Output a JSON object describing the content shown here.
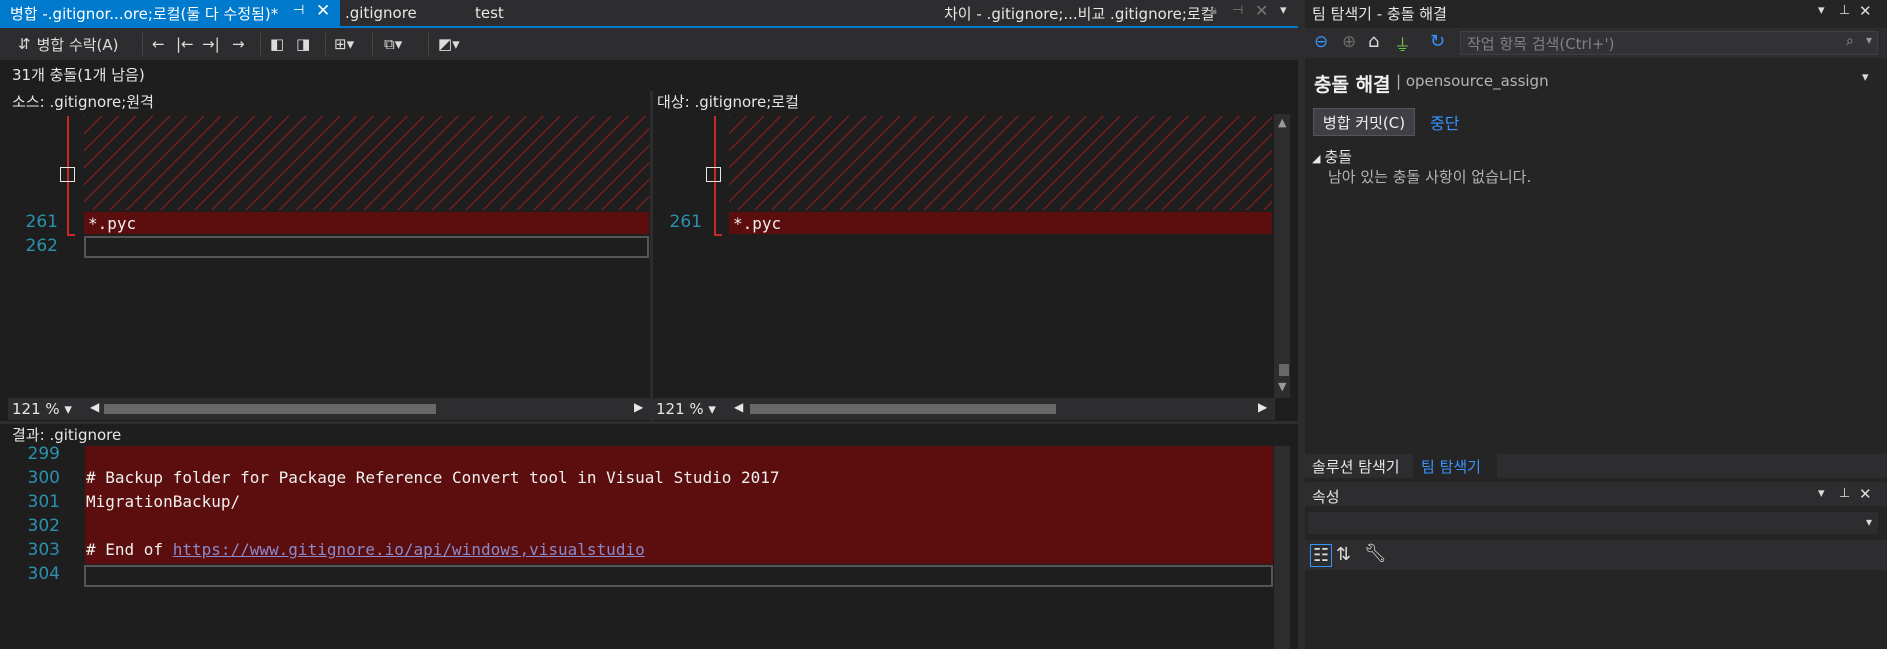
{
  "tabs": {
    "active": ".gitignor...ore;로컬(둘 다 수정됨)*",
    "active_prefix": "병합 - ",
    "items": [
      ".gitignore",
      "test"
    ],
    "right_doc": "차이 - .gitignore;...비교 .gitignore;로컬"
  },
  "toolbar": {
    "accept_merge": "병합 수락(A)"
  },
  "status": "31개 충돌(1개 남음)",
  "source": {
    "label_key": "소스:",
    "label_value": ".gitignore;원격",
    "lines": [
      {
        "num": "261",
        "text": "*.pyc"
      },
      {
        "num": "262",
        "text": ""
      }
    ],
    "zoom": "121 %"
  },
  "target": {
    "label_key": "대상:",
    "label_value": ".gitignore;로컬",
    "lines": [
      {
        "num": "261",
        "text": "*.pyc"
      }
    ],
    "zoom": "121 %"
  },
  "result": {
    "label_key": "결과:",
    "label_value": ".gitignore",
    "lines": [
      {
        "num": "299",
        "text": ""
      },
      {
        "num": "300",
        "text": "# Backup folder for Package Reference Convert tool in Visual Studio 2017"
      },
      {
        "num": "301",
        "text": "MigrationBackup/"
      },
      {
        "num": "302",
        "text": ""
      },
      {
        "num": "303",
        "text": "# End of "
      },
      {
        "num": "304",
        "text": ""
      }
    ],
    "link": "https://www.gitignore.io/api/windows,visualstudio"
  },
  "team_explorer": {
    "title": "팀 탐색기 - 충돌 해결",
    "search_placeholder": "작업 항목 검색(Ctrl+')",
    "heading": "충돌 해결",
    "repo": "| opensource_assign",
    "merge_commit": "병합 커밋(C)",
    "stop": "중단",
    "conflicts_header": "충돌",
    "conflicts_empty": "남아 있는 충돌 사항이 없습니다."
  },
  "bottom_tabs": [
    "솔루션 탐색기",
    "팀 탐색기"
  ],
  "properties": {
    "title": "속성"
  },
  "colors": {
    "accent": "#007acc",
    "conflict": "#5c0d0d",
    "linenum": "#2b91af"
  }
}
